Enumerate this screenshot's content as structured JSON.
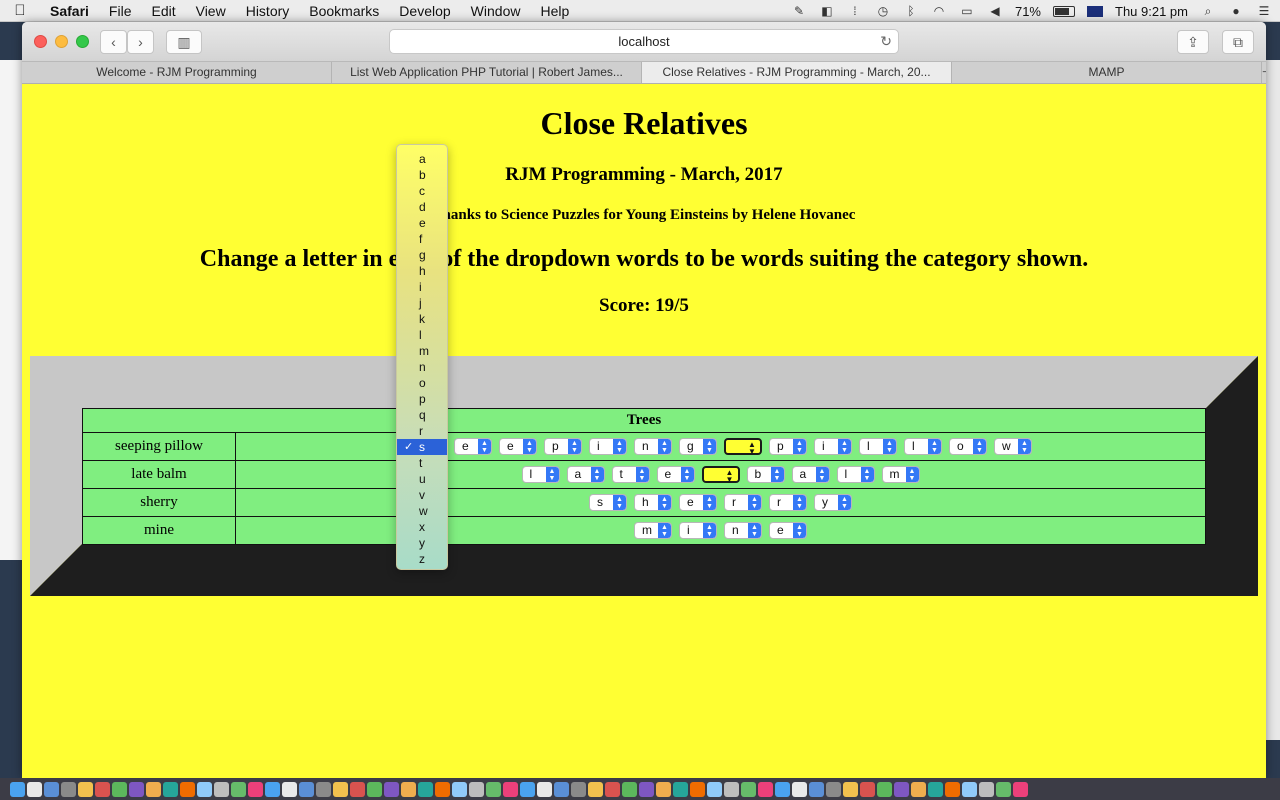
{
  "menubar": {
    "app_name": "Safari",
    "items": [
      "File",
      "Edit",
      "View",
      "History",
      "Bookmarks",
      "Develop",
      "Window",
      "Help"
    ],
    "battery": "71%",
    "clock": "Thu 9:21 pm"
  },
  "browser": {
    "url": "localhost",
    "tabs": [
      {
        "label": "Welcome - RJM Programming",
        "active": false
      },
      {
        "label": "List Web Application PHP Tutorial | Robert James...",
        "active": false
      },
      {
        "label": "Close Relatives - RJM Programming - March, 20...",
        "active": true
      },
      {
        "label": "MAMP",
        "active": false
      }
    ]
  },
  "page": {
    "title": "Close Relatives",
    "subtitle": "RJM Programming - March, 2017",
    "credit": "Thanks to Science Puzzles for Young Einsteins by Helene Hovanec",
    "instructions": "Change a letter in each of the dropdown words to be words suiting the category shown.",
    "score": "Score: 19/5"
  },
  "puzzle": {
    "category": "Trees",
    "rows": [
      {
        "word": "seeping pillow",
        "letters": [
          "s",
          "e",
          "e",
          "p",
          "i",
          "n",
          "g",
          "",
          "p",
          "i",
          "l",
          "l",
          "o",
          "w"
        ]
      },
      {
        "word": "late balm",
        "letters": [
          "l",
          "a",
          "t",
          "e",
          "",
          "b",
          "a",
          "l",
          "m"
        ]
      },
      {
        "word": "sherry",
        "letters": [
          "s",
          "h",
          "e",
          "r",
          "r",
          "y"
        ]
      },
      {
        "word": "mine",
        "letters": [
          "m",
          "i",
          "n",
          "e"
        ]
      }
    ]
  },
  "dropdown": {
    "options": [
      "a",
      "b",
      "c",
      "d",
      "e",
      "f",
      "g",
      "h",
      "i",
      "j",
      "k",
      "l",
      "m",
      "n",
      "o",
      "p",
      "q",
      "r",
      "s",
      "t",
      "u",
      "v",
      "w",
      "x",
      "y",
      "z"
    ],
    "selected": "s"
  }
}
